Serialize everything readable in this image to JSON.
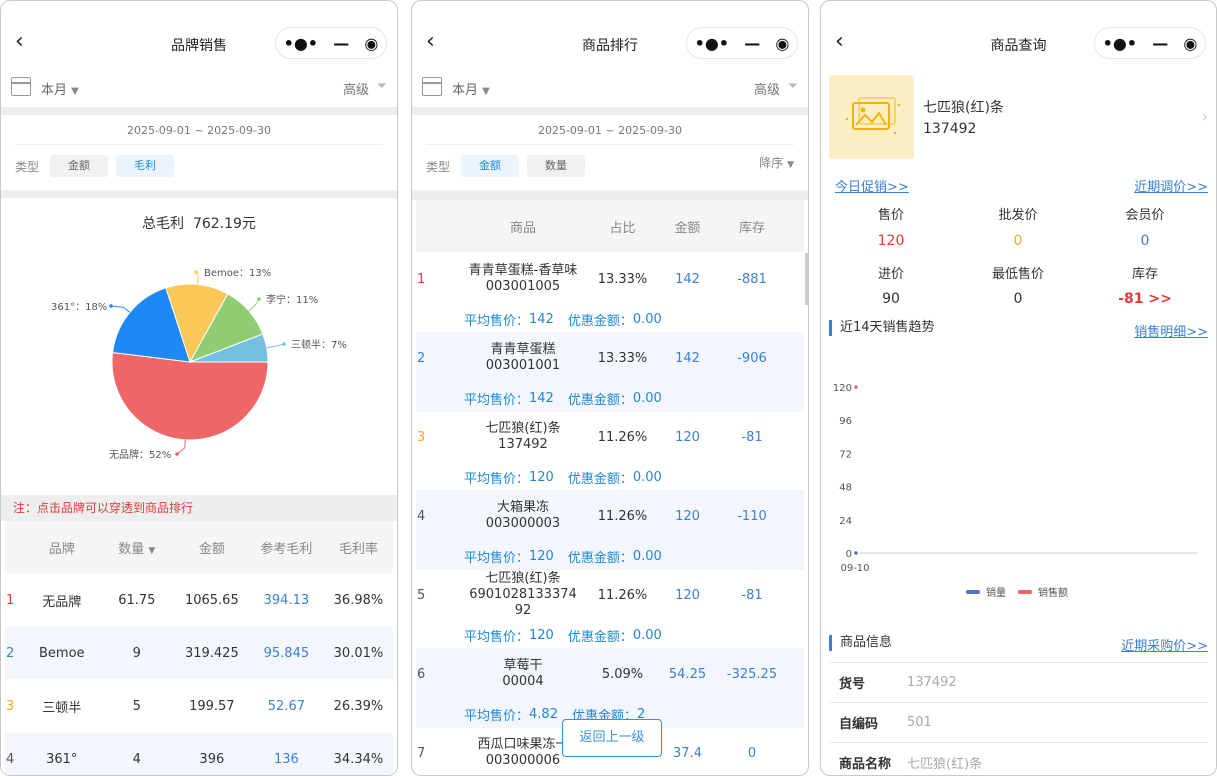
{
  "window": {
    "more_glyph": "•●•",
    "min_glyph": "—",
    "close_glyph": "◉",
    "back_glyph": "‹"
  },
  "brand": {
    "title": "品牌销售",
    "period": "本月",
    "advanced": "高级",
    "date_range": "2025-09-01 ~ 2025-09-30",
    "type_label": "类型",
    "type_options": [
      "金额",
      "毛利"
    ],
    "selected_type": "毛利",
    "total_label": "总毛利",
    "total_value": "762.19元",
    "note": "注：点击品牌可以穿透到商品排行",
    "columns": [
      "品牌",
      "数量",
      "金额",
      "参考毛利",
      "毛利率"
    ],
    "rows": [
      {
        "rank": "1",
        "brand": "无品牌",
        "qty": "61.75",
        "amount": "1065.65",
        "profit": "394.13",
        "rate": "36.98%"
      },
      {
        "rank": "2",
        "brand": "Bemoe",
        "qty": "9",
        "amount": "319.425",
        "profit": "95.845",
        "rate": "30.01%"
      },
      {
        "rank": "3",
        "brand": "三顿半",
        "qty": "5",
        "amount": "199.57",
        "profit": "52.67",
        "rate": "26.39%"
      },
      {
        "rank": "4",
        "brand": "361°",
        "qty": "4",
        "amount": "396",
        "profit": "136",
        "rate": "34.34%"
      }
    ]
  },
  "chart_data": {
    "type": "pie",
    "slices": [
      {
        "label": "无品牌",
        "value": 52,
        "color": "#ee6666"
      },
      {
        "label": "361°",
        "value": 18,
        "color": "#1e88f5"
      },
      {
        "label": "Bemoe",
        "value": 13,
        "color": "#fac858"
      },
      {
        "label": "李宁",
        "value": 11,
        "color": "#91cc75"
      },
      {
        "label": "三顿半",
        "value": 7,
        "color": "#73c0de"
      }
    ]
  },
  "ranking": {
    "title": "商品排行",
    "period": "本月",
    "advanced": "高级",
    "date_range": "2025-09-01 ~ 2025-09-30",
    "type_label": "类型",
    "type_options": [
      "金额",
      "数量"
    ],
    "sort": "降序",
    "columns": [
      "商品",
      "占比",
      "金额",
      "库存"
    ],
    "avg_label": "平均售价：",
    "discount_label": "优惠金额：",
    "back_button": "返回上一级",
    "rows": [
      {
        "rank": "1",
        "name": "青青草蛋糕-香草味",
        "code": "003001005",
        "share": "13.33%",
        "amount": "142",
        "stock": "-881",
        "avg": "142",
        "discount": "0.00"
      },
      {
        "rank": "2",
        "name": "青青草蛋糕",
        "code": "003001001",
        "share": "13.33%",
        "amount": "142",
        "stock": "-906",
        "avg": "142",
        "discount": "0.00"
      },
      {
        "rank": "3",
        "name": "七匹狼(红)条",
        "code": "137492",
        "share": "11.26%",
        "amount": "120",
        "stock": "-81",
        "avg": "120",
        "discount": "0.00"
      },
      {
        "rank": "4",
        "name": "大箱果冻",
        "code": "003000003",
        "share": "11.26%",
        "amount": "120",
        "stock": "-110",
        "avg": "120",
        "discount": "0.00"
      },
      {
        "rank": "5",
        "name": "七匹狼(红)条",
        "code": "6901028133374 92",
        "share": "11.26%",
        "amount": "120",
        "stock": "-81",
        "avg": "120",
        "discount": "0.00"
      },
      {
        "rank": "6",
        "name": "草莓干",
        "code": "00004",
        "share": "5.09%",
        "amount": "54.25",
        "stock": "-325.25",
        "avg": "4.82",
        "discount": "2"
      },
      {
        "rank": "7",
        "name": "西瓜口味果冻一",
        "code": "003000006",
        "share": "",
        "amount": "37.4",
        "stock": "0",
        "avg": "",
        "discount": ""
      }
    ]
  },
  "product": {
    "title": "商品查询",
    "name": "七匹狼(红)条",
    "code": "137492",
    "promo_link": "今日促销>>",
    "price_change_link": "近期调价>>",
    "prices": [
      {
        "label": "售价",
        "value": "120",
        "color": "#e53935"
      },
      {
        "label": "批发价",
        "value": "0",
        "color": "#f5a623"
      },
      {
        "label": "会员价",
        "value": "0",
        "color": "#3b7fd6"
      },
      {
        "label": "进价",
        "value": "90",
        "color": "#333333"
      },
      {
        "label": "最低售价",
        "value": "0",
        "color": "#333333"
      },
      {
        "label": "库存",
        "value": "-81 >>",
        "color": "#e53935"
      }
    ],
    "trend_title": "近14天销售趋势",
    "sales_detail_link": "销售明细>>",
    "trend_chart": {
      "y_ticks": [
        "120",
        "96",
        "72",
        "48",
        "24",
        "0"
      ],
      "x_label": "09-10",
      "legend": [
        {
          "name": "销量",
          "color": "#5470c6"
        },
        {
          "name": "销售额",
          "color": "#ee6666"
        }
      ],
      "sales_amount_value": 120,
      "sales_qty_value": 0
    },
    "info_title": "商品信息",
    "purchase_link": "近期采购价>>",
    "info": [
      {
        "key": "货号",
        "value": "137492"
      },
      {
        "key": "自编码",
        "value": "501"
      },
      {
        "key": "商品名称",
        "value": "七匹狼(红)条"
      }
    ]
  }
}
